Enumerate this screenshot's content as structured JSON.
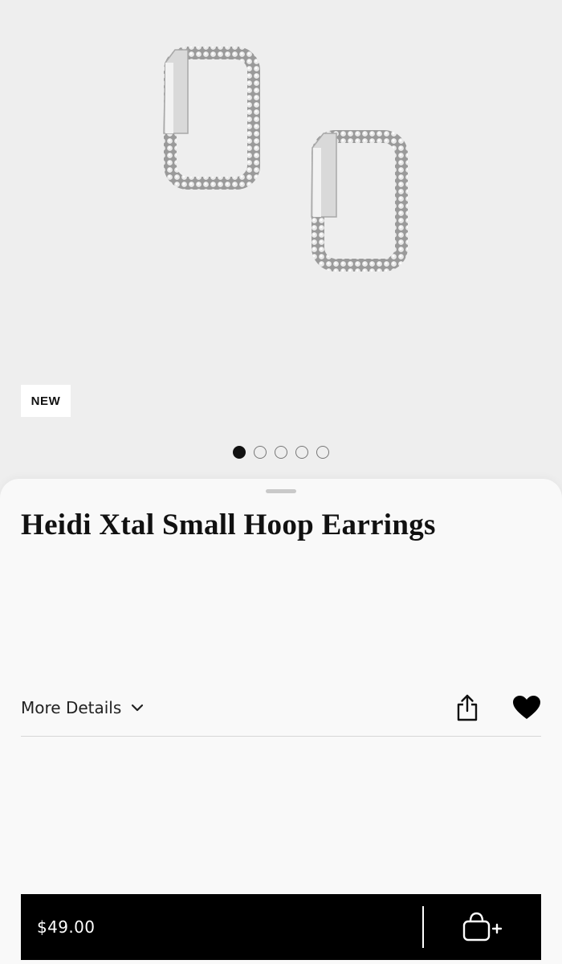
{
  "product": {
    "badge": "NEW",
    "image_icon": "earrings-image",
    "carousel": {
      "count": 5,
      "active_index": 0
    },
    "title": "Heidi Xtal Small Hoop Earrings",
    "more_details_label": "More Details",
    "favorited": true
  },
  "icons": {
    "chevron": "chevron-down-icon",
    "share": "share-icon",
    "favorite": "heart-icon",
    "bag": "shopping-bag-plus-icon"
  },
  "purchase": {
    "price": "$49.00"
  },
  "colors": {
    "background": "#eeeeee",
    "sheet": "#f9f9f9",
    "buy_bar": "#000000",
    "text": "#111111"
  }
}
